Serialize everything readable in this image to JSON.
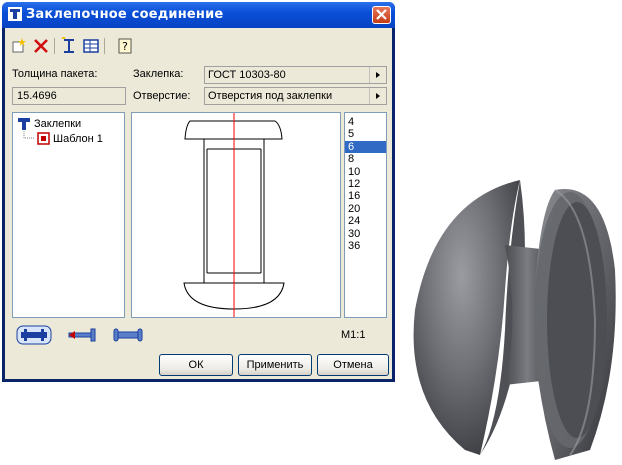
{
  "window": {
    "title": "Заклепочное соединение"
  },
  "toolbar": {
    "icons": [
      "new-icon",
      "delete-icon",
      "insert-icon",
      "table-icon",
      "help-icon"
    ]
  },
  "form": {
    "thickness_label": "Толщина пакета:",
    "thickness_value": "15.4696",
    "rivet_label": "Заклепка:",
    "rivet_value": "ГОСТ 10303-80",
    "hole_label": "Отверстие:",
    "hole_value": "Отверстия под заклепки"
  },
  "tree": {
    "root": "Заклепки",
    "child": "Шаблон 1"
  },
  "sizes": {
    "items": [
      "4",
      "5",
      "6",
      "8",
      "10",
      "12",
      "16",
      "20",
      "24",
      "30",
      "36"
    ],
    "selected": "6"
  },
  "bottom": {
    "scale": "М1:1",
    "ok": "ОК",
    "apply": "Применить",
    "cancel": "Отмена"
  },
  "colors": {
    "title_bar": "#0a4fd8",
    "selection": "#316ac5",
    "axis_line": "#ff0000"
  }
}
